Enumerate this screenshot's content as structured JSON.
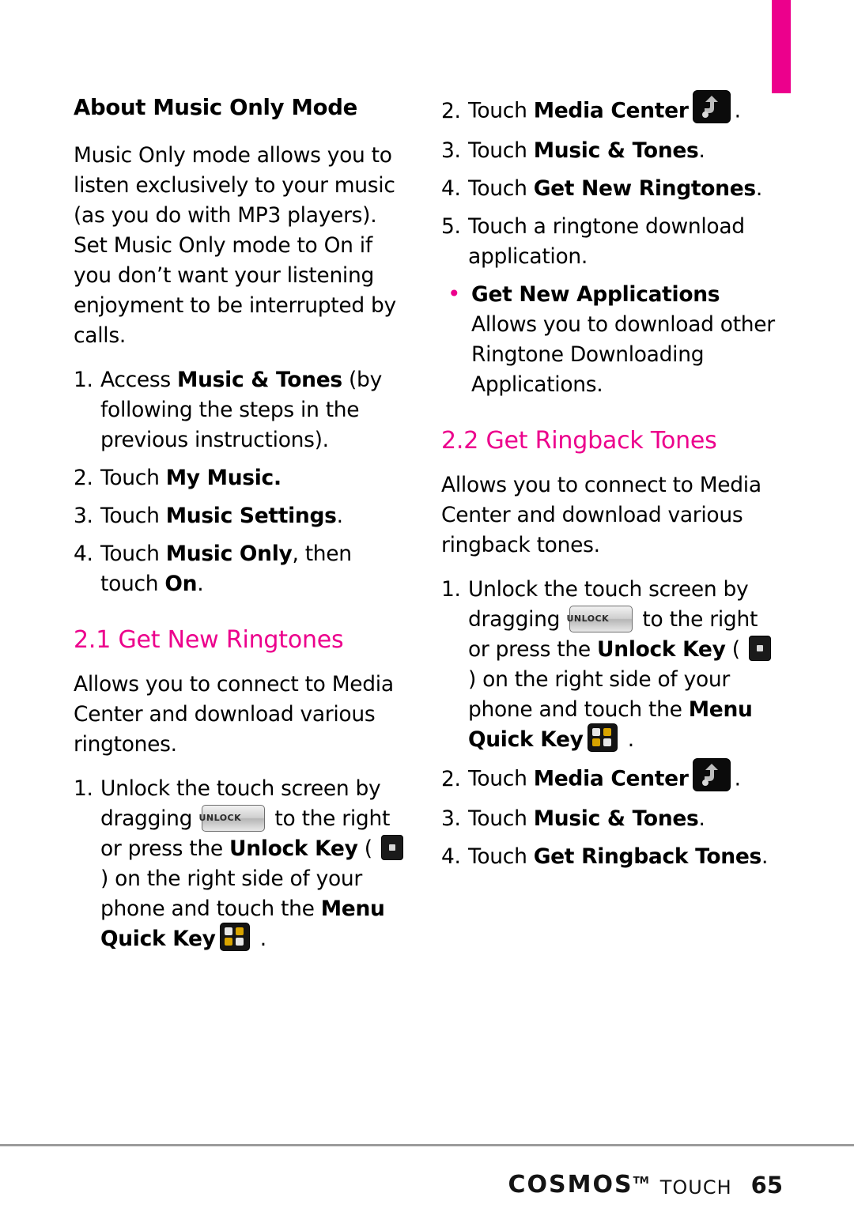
{
  "page": {
    "number": "65",
    "brand": "COSMOS",
    "brand_tm": "TM",
    "brand_suffix": "TOUCH",
    "accent_color": "#ec008c"
  },
  "left_column": {
    "heading": "About Music Only Mode",
    "intro": "Music Only mode allows you to listen exclusively to your music (as you do with MP3 players). Set Music Only mode to On if you don’t want your listening enjoyment to be interrupted by calls.",
    "steps": [
      {
        "num": "1.",
        "pre": "Access ",
        "bold": "Music & Tones",
        "post": " (by following the steps in the previous instructions)."
      },
      {
        "num": "2.",
        "pre": "Touch ",
        "bold": "My Music.",
        "post": ""
      },
      {
        "num": "3.",
        "pre": "Touch ",
        "bold": "Music Settings",
        "post": "."
      },
      {
        "num": "4.",
        "pre": "Touch ",
        "bold": "Music Only",
        "post": ", then touch ",
        "bold2": "On",
        "post2": "."
      }
    ],
    "section_title": "2.1 Get New Ringtones",
    "section_intro": "Allows you to connect to Media Center and download various ringtones.",
    "unlock_step": {
      "num": "1.",
      "t1": "Unlock the touch screen by dragging ",
      "icon1": "unlock-slider-icon",
      "icon1_label": "UNLOCK",
      "t2": " to the right or press the ",
      "bold1": "Unlock Key",
      "t3": " ( ",
      "icon2": "unlock-key-icon",
      "t4": " ) on the right side of your phone and touch the ",
      "bold2": "Menu Quick Key",
      "icon3": "menu-quick-key-icon",
      "t5": " ."
    }
  },
  "right_column": {
    "steps_top": [
      {
        "num": "2.",
        "pre": "Touch ",
        "bold": "Media Center",
        "icon": "media-center-icon",
        "post": "."
      },
      {
        "num": "3.",
        "pre": "Touch ",
        "bold": "Music & Tones",
        "post": "."
      },
      {
        "num": "4.",
        "pre": "Touch ",
        "bold": "Get New Ringtones",
        "post": "."
      },
      {
        "num": "5.",
        "pre": "Touch a ringtone download application.",
        "bold": "",
        "post": ""
      }
    ],
    "bullet": {
      "bold": "Get New Applications",
      "text": " Allows you to download other Ringtone Downloading Applications."
    },
    "section_title": "2.2 Get Ringback Tones",
    "section_intro": "Allows you to connect to Media Center and download various ringback tones.",
    "unlock_step": {
      "num": "1.",
      "t1": "Unlock the touch screen by dragging ",
      "icon1": "unlock-slider-icon",
      "icon1_label": "UNLOCK",
      "t2": " to the right or press the ",
      "bold1": "Unlock Key",
      "t3": " ( ",
      "icon2": "unlock-key-icon",
      "t4": " ) on the right side of your phone and touch the ",
      "bold2": "Menu Quick Key",
      "icon3": "menu-quick-key-icon",
      "t5": " ."
    },
    "steps_bottom": [
      {
        "num": "2.",
        "pre": "Touch ",
        "bold": "Media Center",
        "icon": "media-center-icon",
        "post": "."
      },
      {
        "num": "3.",
        "pre": "Touch ",
        "bold": "Music & Tones",
        "post": "."
      },
      {
        "num": "4.",
        "pre": "Touch ",
        "bold": "Get Ringback Tones",
        "post": "."
      }
    ]
  }
}
